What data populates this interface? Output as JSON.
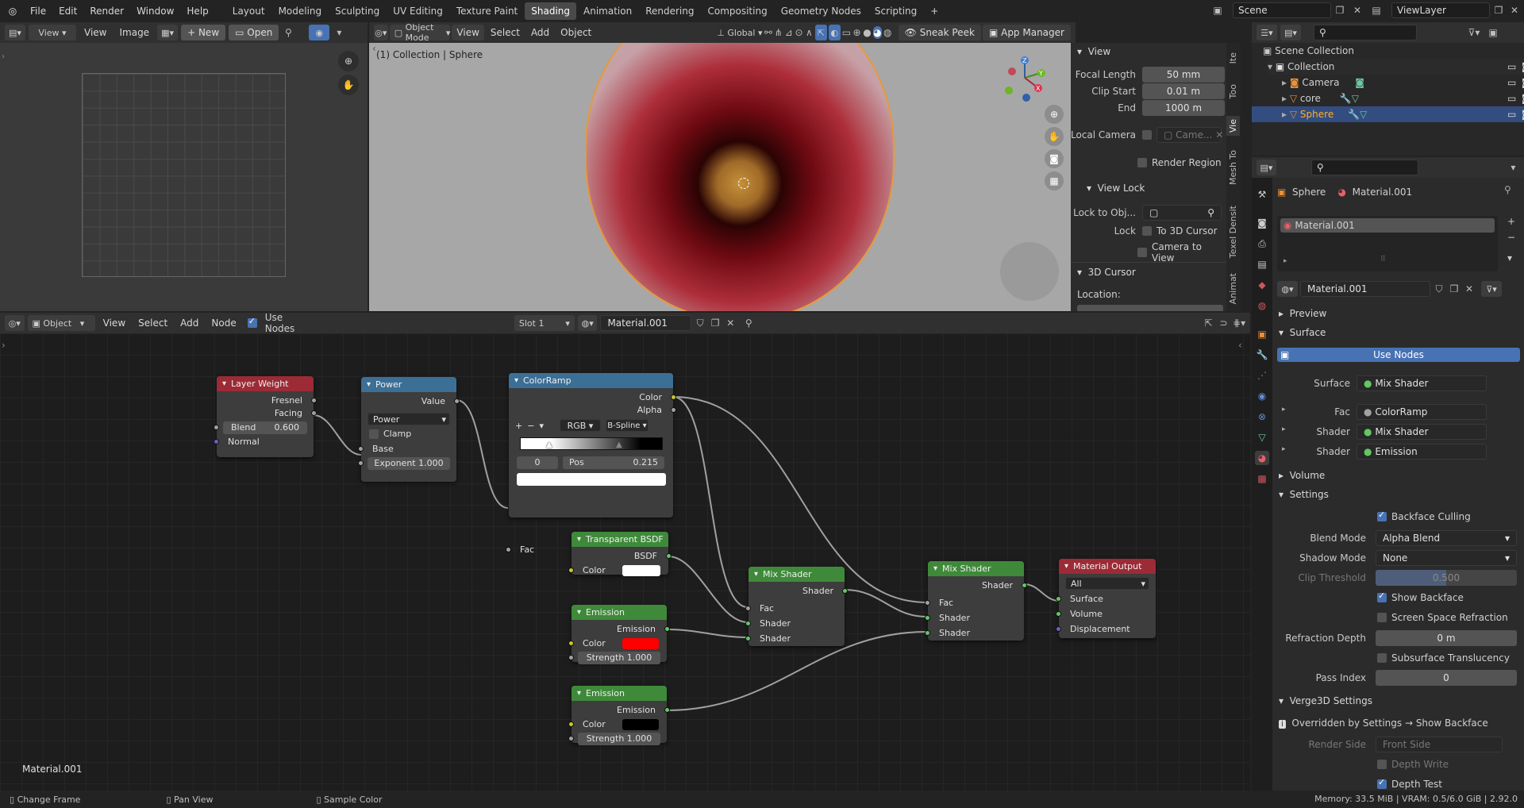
{
  "topbar": {
    "menus": [
      "File",
      "Edit",
      "Render",
      "Window",
      "Help"
    ],
    "workspaces": [
      "Layout",
      "Modeling",
      "Sculpting",
      "UV Editing",
      "Texture Paint",
      "Shading",
      "Animation",
      "Rendering",
      "Compositing",
      "Geometry Nodes",
      "Scripting"
    ],
    "active_workspace": "Shading",
    "scene": "Scene",
    "view_layer": "ViewLayer"
  },
  "image_editor": {
    "view_label": "View",
    "menus": [
      "View",
      "Image"
    ],
    "new_label": "New",
    "open_label": "Open"
  },
  "viewport": {
    "mode": "Object Mode",
    "menus": [
      "View",
      "Select",
      "Add",
      "Object"
    ],
    "transform_orientation": "Global",
    "sneak_peek": "Sneak Peek",
    "app_manager": "App Manager",
    "overlay_text": "(1) Collection | Sphere",
    "sidebar": {
      "view_header": "View",
      "focal_length_label": "Focal Length",
      "focal_length": "50 mm",
      "clip_start_label": "Clip Start",
      "clip_start": "0.01 m",
      "end_label": "End",
      "end": "1000 m",
      "local_camera_label": "Local Camera",
      "local_camera_value": "Came...",
      "render_region": "Render Region",
      "view_lock_header": "View Lock",
      "lock_to_obj_label": "Lock to Obj...",
      "lock_label": "Lock",
      "to_3d_cursor": "To 3D Cursor",
      "camera_to_view": "Camera to View",
      "cursor_header": "3D Cursor",
      "location_label": "Location:",
      "tabs": [
        "Ite",
        "Too",
        "Vie",
        "Mesh To",
        "Texel Densit",
        "Animat"
      ]
    }
  },
  "outliner": {
    "scene_collection": "Scene Collection",
    "items": [
      {
        "name": "Collection"
      },
      {
        "name": "Camera"
      },
      {
        "name": "core"
      },
      {
        "name": "Sphere"
      }
    ]
  },
  "node_editor": {
    "editor_type": "Object",
    "menus": [
      "View",
      "Select",
      "Add",
      "Node"
    ],
    "use_nodes": "Use Nodes",
    "slot": "Slot 1",
    "material": "Material.001",
    "footer_material": "Material.001",
    "nodes": {
      "layer_weight": {
        "title": "Layer Weight",
        "out1": "Fresnel",
        "out2": "Facing",
        "blend_label": "Blend",
        "blend": "0.600",
        "normal": "Normal"
      },
      "power": {
        "title": "Power",
        "out": "Value",
        "op": "Power",
        "clamp": "Clamp",
        "base": "Base",
        "exponent": "Exponent  1.000"
      },
      "colorramp": {
        "title": "ColorRamp",
        "out1": "Color",
        "out2": "Alpha",
        "mode": "RGB",
        "interp": "B-Spline",
        "index": "0",
        "pos_label": "Pos",
        "pos": "0.215",
        "fac": "Fac"
      },
      "transparent": {
        "title": "Transparent BSDF",
        "out": "BSDF",
        "color": "Color"
      },
      "emission1": {
        "title": "Emission",
        "out": "Emission",
        "color": "Color",
        "strength": "Strength  1.000",
        "swatch": "#ff0000"
      },
      "emission2": {
        "title": "Emission",
        "out": "Emission",
        "color": "Color",
        "strength": "Strength  1.000",
        "swatch": "#000000"
      },
      "mix1": {
        "title": "Mix Shader",
        "out": "Shader",
        "fac": "Fac",
        "in1": "Shader",
        "in2": "Shader"
      },
      "mix2": {
        "title": "Mix Shader",
        "out": "Shader",
        "fac": "Fac",
        "in1": "Shader",
        "in2": "Shader"
      },
      "output": {
        "title": "Material Output",
        "target": "All",
        "surface": "Surface",
        "volume": "Volume",
        "displacement": "Displacement"
      }
    }
  },
  "properties": {
    "breadcrumb_object": "Sphere",
    "breadcrumb_material": "Material.001",
    "slot_item": "Material.001",
    "material_name": "Material.001",
    "preview": "Preview",
    "surface": "Surface",
    "use_nodes": "Use Nodes",
    "surface_label": "Surface",
    "surface_value": "Mix Shader",
    "fac_label": "Fac",
    "fac_value": "ColorRamp",
    "shader1_label": "Shader",
    "shader1_value": "Mix Shader",
    "shader2_label": "Shader",
    "shader2_value": "Emission",
    "volume": "Volume",
    "settings": "Settings",
    "backface_culling": "Backface Culling",
    "blend_mode_label": "Blend Mode",
    "blend_mode": "Alpha Blend",
    "shadow_mode_label": "Shadow Mode",
    "shadow_mode": "None",
    "clip_threshold_label": "Clip Threshold",
    "clip_threshold": "0.500",
    "show_backface": "Show Backface",
    "ssr": "Screen Space Refraction",
    "refraction_depth_label": "Refraction Depth",
    "refraction_depth": "0 m",
    "subsurface": "Subsurface Translucency",
    "pass_index_label": "Pass Index",
    "pass_index": "0",
    "verge_header": "Verge3D Settings",
    "verge_note": "Overridden by Settings → Show Backface",
    "render_side_label": "Render Side",
    "render_side": "Front Side",
    "depth_write": "Depth Write",
    "depth_test": "Depth Test"
  },
  "statusbar": {
    "hint1": "Change Frame",
    "hint2": "Pan View",
    "hint3": "Sample Color",
    "memory": "Memory: 33.5 MiB | VRAM: 0.5/6.0 GiB | 2.92.0"
  }
}
